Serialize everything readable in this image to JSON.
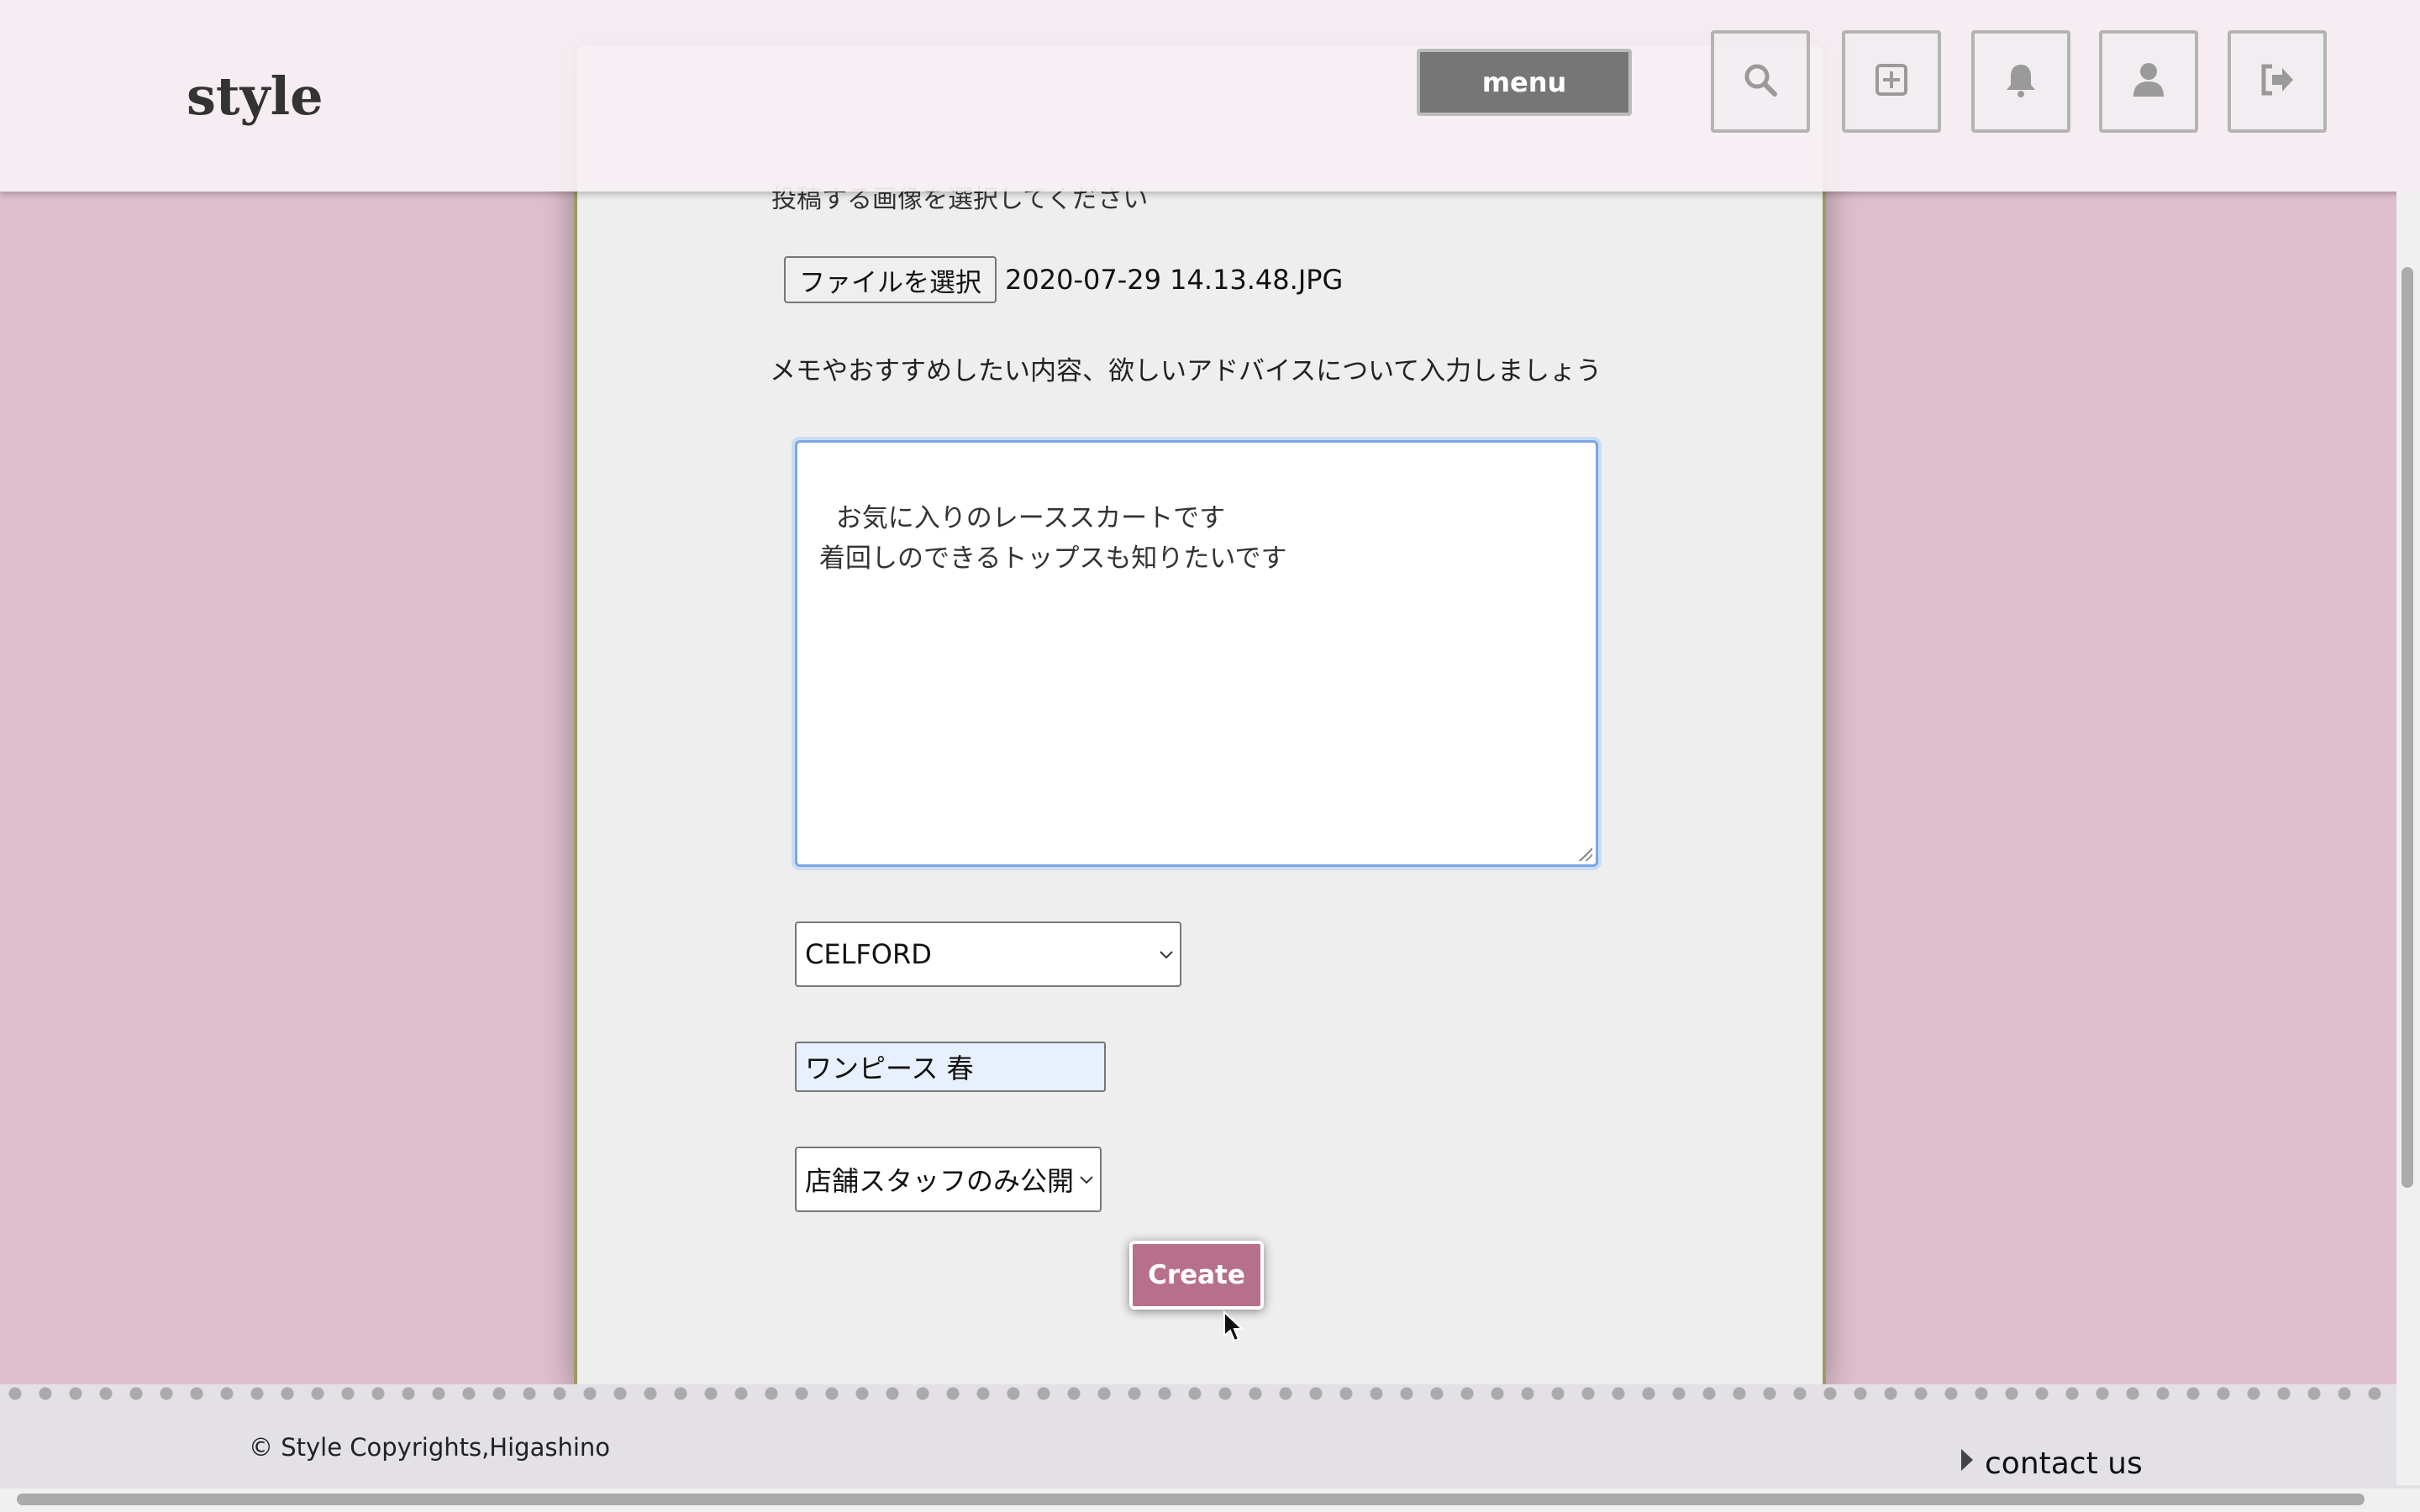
{
  "header": {
    "logo": "style",
    "menu_label": "menu",
    "icons": [
      "search-icon",
      "add-post-icon",
      "bell-icon",
      "user-icon",
      "logout-icon"
    ]
  },
  "form": {
    "image_prompt": "投稿する画像を選択してください",
    "file_button": "ファイルを選択",
    "file_name": "2020-07-29 14.13.48.JPG",
    "memo_prompt": "メモやおすすめしたい内容、欲しいアドバイスについて入力しましょう",
    "memo_value": "お気に入りのレーススカートです\n着回しのできるトップスも知りたいです",
    "brand_selected": "CELFORD",
    "tag_value": "ワンピース 春",
    "visibility_selected": "店舗スタッフのみ公開",
    "submit_label": "Create"
  },
  "footer": {
    "copyright": "© Style Copyrights,Higashino",
    "contact": "contact us"
  },
  "colors": {
    "background": "#dfbfce",
    "accent": "#b7708b",
    "card": "#eeeeee"
  }
}
